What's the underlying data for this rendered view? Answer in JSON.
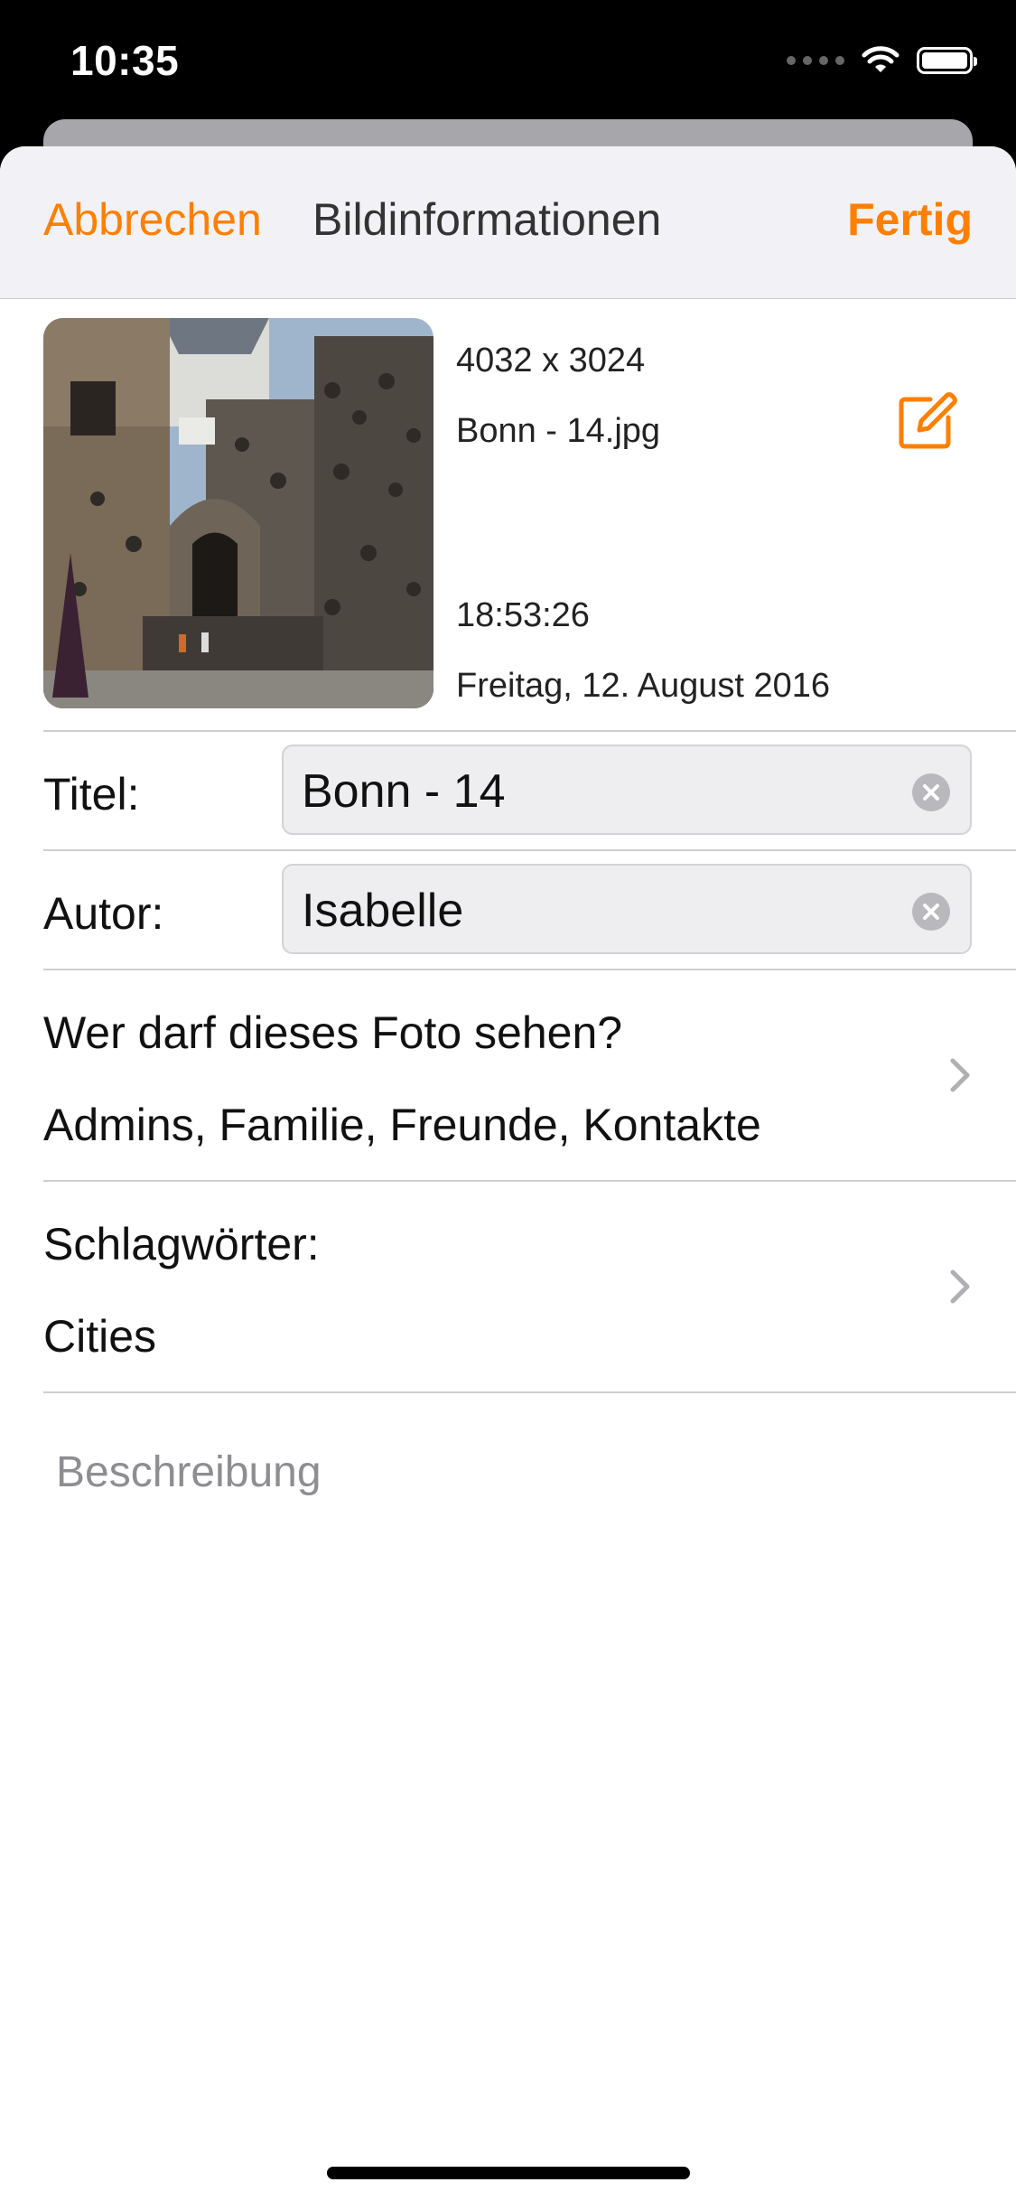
{
  "status_bar": {
    "time": "10:35"
  },
  "nav": {
    "cancel": "Abbrechen",
    "title": "Bildinformationen",
    "done": "Fertig"
  },
  "photo": {
    "dimensions": "4032 x 3024",
    "filename": "Bonn - 14.jpg",
    "time": "18:53:26",
    "date": "Freitag, 12. August 2016",
    "edit_icon": "square-pencil-icon"
  },
  "fields": {
    "title": {
      "label": "Titel:",
      "value": "Bonn - 14"
    },
    "author": {
      "label": "Autor:",
      "value": "Isabelle"
    }
  },
  "privacy": {
    "label": "Wer darf dieses Foto sehen?",
    "value": "Admins, Familie, Freunde, Kontakte"
  },
  "tags": {
    "label": "Schlagwörter:",
    "value": "Cities"
  },
  "description": {
    "placeholder": "Beschreibung"
  },
  "colors": {
    "accent": "#ff7f00",
    "nav_bg": "#f2f2f6",
    "field_bg": "#eeeef0"
  }
}
